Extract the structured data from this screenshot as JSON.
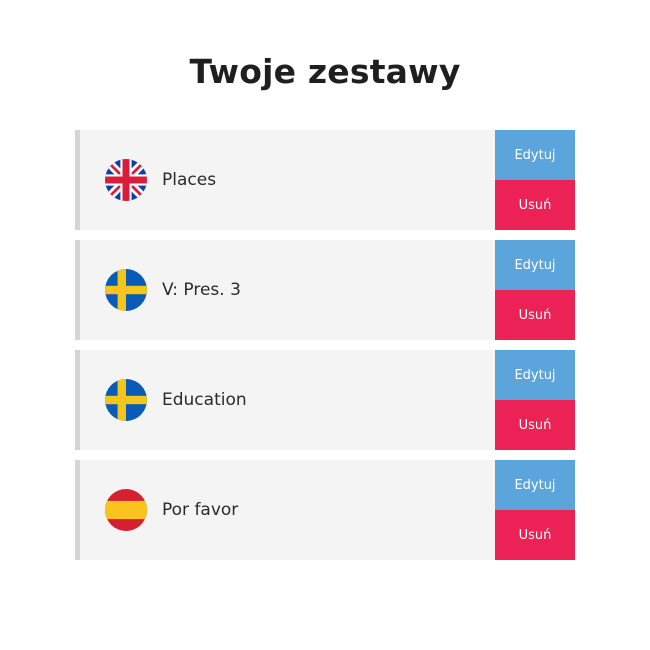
{
  "page": {
    "title": "Twoje zestawy"
  },
  "sets": [
    {
      "name": "Places",
      "flag": "uk-flag-icon",
      "edit_label": "Edytuj",
      "delete_label": "Usuń"
    },
    {
      "name": "V: Pres. 3",
      "flag": "sweden-flag-icon",
      "edit_label": "Edytuj",
      "delete_label": "Usuń"
    },
    {
      "name": "Education",
      "flag": "sweden-flag-icon",
      "edit_label": "Edytuj",
      "delete_label": "Usuń"
    },
    {
      "name": "Por favor",
      "flag": "spain-flag-icon",
      "edit_label": "Edytuj",
      "delete_label": "Usuń"
    }
  ],
  "colors": {
    "edit_button": "#5ba4dc",
    "delete_button": "#ec2155",
    "card_background": "#f4f4f4",
    "card_border": "#d4d4d4"
  }
}
